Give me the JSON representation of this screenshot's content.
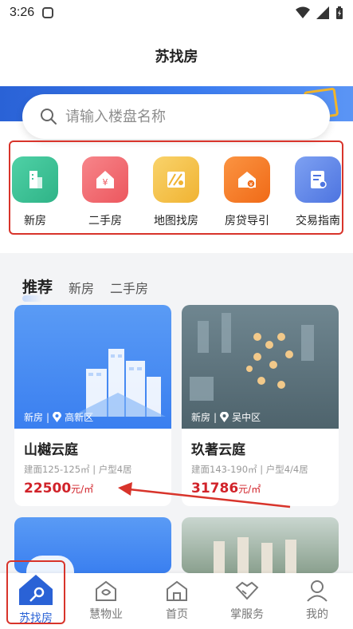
{
  "status": {
    "time": "3:26"
  },
  "title": "苏找房",
  "search": {
    "placeholder": "请输入楼盘名称"
  },
  "categories": [
    {
      "label": "新房",
      "color": "#3fc49a",
      "icon": "building-icon"
    },
    {
      "label": "二手房",
      "color": "#f26d72",
      "icon": "house-yen-icon"
    },
    {
      "label": "地图找房",
      "color": "#f5c24c",
      "icon": "map-icon"
    },
    {
      "label": "房贷导引",
      "color": "#f77b27",
      "icon": "loan-house-icon"
    },
    {
      "label": "交易指南",
      "color": "#5f86e8",
      "icon": "guide-doc-icon"
    }
  ],
  "tabs": [
    "推荐",
    "新房",
    "二手房"
  ],
  "listings": [
    {
      "type": "新房",
      "district": "高新区",
      "name": "山樾云庭",
      "spec": "建面125-125㎡ | 户型4居",
      "price": "22500",
      "unit": "元/㎡"
    },
    {
      "type": "新房",
      "district": "吴中区",
      "name": "玖著云庭",
      "spec": "建面143-190㎡ | 户型4/4居",
      "price": "31786",
      "unit": "元/㎡"
    }
  ],
  "nav": [
    {
      "label": "苏找房",
      "icon": "home-key-icon",
      "active": true
    },
    {
      "label": "慧物业",
      "icon": "property-icon"
    },
    {
      "label": "首页",
      "icon": "house-icon"
    },
    {
      "label": "掌服务",
      "icon": "handshake-icon"
    },
    {
      "label": "我的",
      "icon": "person-icon"
    }
  ],
  "colors": {
    "accent": "#2a62d6",
    "price": "#d1232a",
    "highlight": "#d8342b"
  }
}
